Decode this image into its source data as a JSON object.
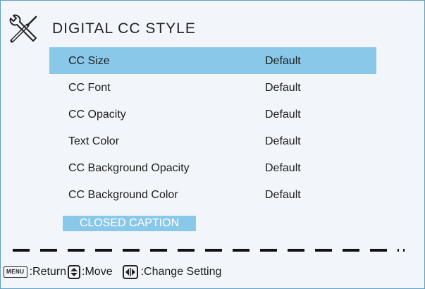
{
  "header": {
    "title": "DIGITAL CC STYLE",
    "icon": "tools-icon"
  },
  "menu": {
    "items": [
      {
        "label": "CC Size",
        "value": "Default",
        "selected": true
      },
      {
        "label": "CC Font",
        "value": "Default",
        "selected": false
      },
      {
        "label": "CC Opacity",
        "value": "Default",
        "selected": false
      },
      {
        "label": "Text Color",
        "value": "Default",
        "selected": false
      },
      {
        "label": "CC Background Opacity",
        "value": "Default",
        "selected": false
      },
      {
        "label": "CC Background Color",
        "value": "Default",
        "selected": false
      }
    ]
  },
  "closed_caption_button": "CLOSED CAPTION",
  "footer": {
    "menu_key": "MENU",
    "return_label": ":Return",
    "move_label": ":Move",
    "change_label": ":Change Setting"
  },
  "colors": {
    "highlight": "#8ac8ea",
    "border": "#5f9ec4",
    "background": "#f2f6fa"
  }
}
